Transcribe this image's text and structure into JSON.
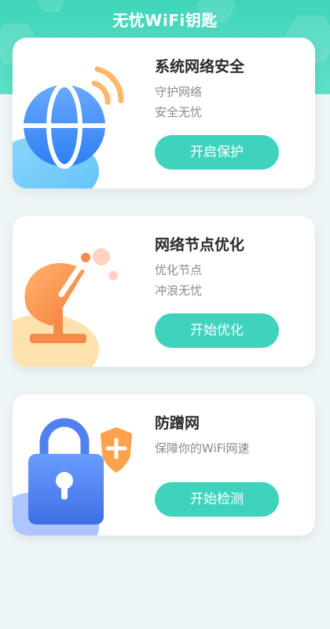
{
  "header": {
    "title": "无忧WiFi钥匙"
  },
  "cards": [
    {
      "title": "系统网络安全",
      "lines": [
        "守护网络",
        "安全无忧"
      ],
      "button": "开启保护",
      "icon": "globe-wifi-icon"
    },
    {
      "title": "网络节点优化",
      "lines": [
        "优化节点",
        "冲浪无忧"
      ],
      "button": "开始优化",
      "icon": "satellite-dish-icon"
    },
    {
      "title": "防蹭网",
      "lines": [
        "保障你的WiFi网速"
      ],
      "button": "开始检测",
      "icon": "padlock-shield-icon"
    }
  ],
  "colors": {
    "header": "#3fd5b9",
    "button": "#3fd3bd",
    "page_bg": "#eef5f7"
  }
}
